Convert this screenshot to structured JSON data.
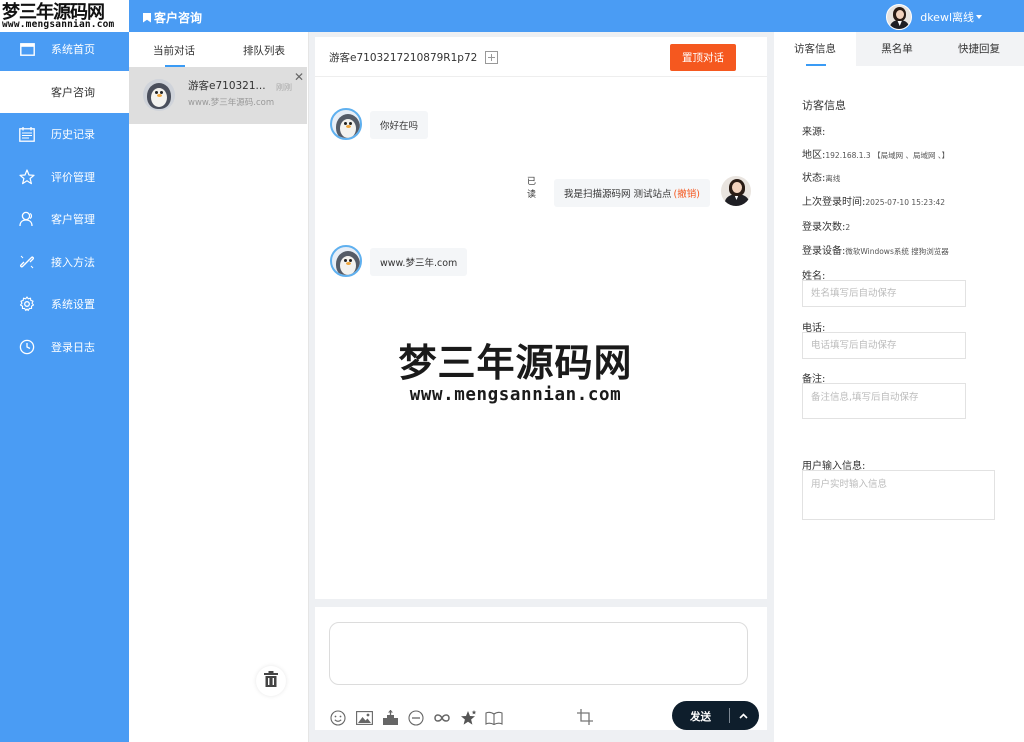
{
  "brand": {
    "name_cn": "梦三年源码网",
    "name_en": "www.mengsannian.com"
  },
  "topbar": {
    "title": "客户咨询",
    "username": "dkewl离线"
  },
  "sidebar": {
    "items": [
      {
        "label": "系统首页",
        "icon": "window-icon"
      },
      {
        "label": "客户咨询",
        "icon": "none",
        "active": true
      },
      {
        "label": "历史记录",
        "icon": "calendar-list-icon"
      },
      {
        "label": "评价管理",
        "icon": "star-icon"
      },
      {
        "label": "客户管理",
        "icon": "user-icon"
      },
      {
        "label": "接入方法",
        "icon": "link-icon"
      },
      {
        "label": "系统设置",
        "icon": "gear-icon"
      },
      {
        "label": "登录日志",
        "icon": "clock-icon"
      }
    ]
  },
  "conversations": {
    "tabs": [
      {
        "label": "当前对话",
        "active": true
      },
      {
        "label": "排队列表"
      }
    ],
    "items": [
      {
        "name": "游客e710321...",
        "sub": "www.梦三年源码.com",
        "time": "刚刚"
      }
    ]
  },
  "chat": {
    "guest_id": "游客e7103217210879R1p72",
    "pin_label": "置顶对话",
    "messages": [
      {
        "from": "visitor",
        "text": "你好在吗"
      },
      {
        "from": "agent",
        "text": "我是扫描源码网 测试站点",
        "recall": "(撤销)",
        "read": "已读"
      },
      {
        "from": "visitor",
        "text": "www.梦三年.com"
      }
    ],
    "watermark": {
      "cn": "梦三年源码网",
      "en": "www.mengsannian.com"
    }
  },
  "compose": {
    "send_label": "发送"
  },
  "info": {
    "tabs": [
      {
        "label": "访客信息",
        "active": true
      },
      {
        "label": "黑名单"
      },
      {
        "label": "快捷回复"
      }
    ],
    "heading": "访客信息",
    "source_label": "来源:",
    "region_label": "地区:",
    "region_value": "192.168.1.3 【局域网 、局域网 、】",
    "status_label": "状态:",
    "status_value": "离线",
    "last_login_label": "上次登录时间:",
    "last_login_value": "2025-07-10 15:23:42",
    "login_count_label": "登录次数:",
    "login_count_value": "2",
    "device_label": "登录设备:",
    "device_value": "微软Windows系统 搜狗浏览器",
    "name_label": "姓名:",
    "name_placeholder": "姓名填写后自动保存",
    "phone_label": "电话:",
    "phone_placeholder": "电话填写后自动保存",
    "note_label": "备注:",
    "note_placeholder": "备注信息,填写后自动保存",
    "user_input_label": "用户输入信息:",
    "user_input_placeholder": "用户实时输入信息"
  },
  "colors": {
    "primary": "#4a9cf4",
    "accent": "#f5581f",
    "send": "#0e1e2c"
  }
}
